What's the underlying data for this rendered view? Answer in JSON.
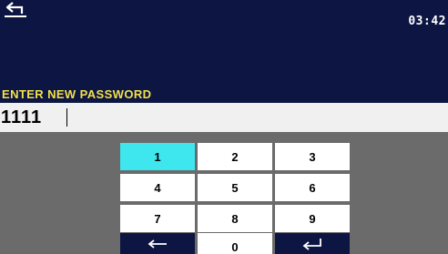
{
  "header": {
    "time": "03:42",
    "back_icon": "back-arrow-icon"
  },
  "prompt": {
    "label": "ENTER NEW PASSWORD"
  },
  "password": {
    "value": "1111"
  },
  "keypad": {
    "keys": [
      {
        "label": "1",
        "active": true
      },
      {
        "label": "2"
      },
      {
        "label": "3"
      },
      {
        "label": "4"
      },
      {
        "label": "5"
      },
      {
        "label": "6"
      },
      {
        "label": "7"
      },
      {
        "label": "8"
      },
      {
        "label": "9"
      },
      {
        "icon": "backspace-arrow-icon"
      },
      {
        "label": "0"
      },
      {
        "icon": "enter-icon"
      }
    ],
    "colors": {
      "active": "#3ee6ee",
      "key": "#ffffff",
      "action_key": "#0d1543"
    }
  },
  "colors": {
    "header": "#0d1543",
    "prompt_text": "#f2e14a",
    "background": "#6b6b6b"
  }
}
